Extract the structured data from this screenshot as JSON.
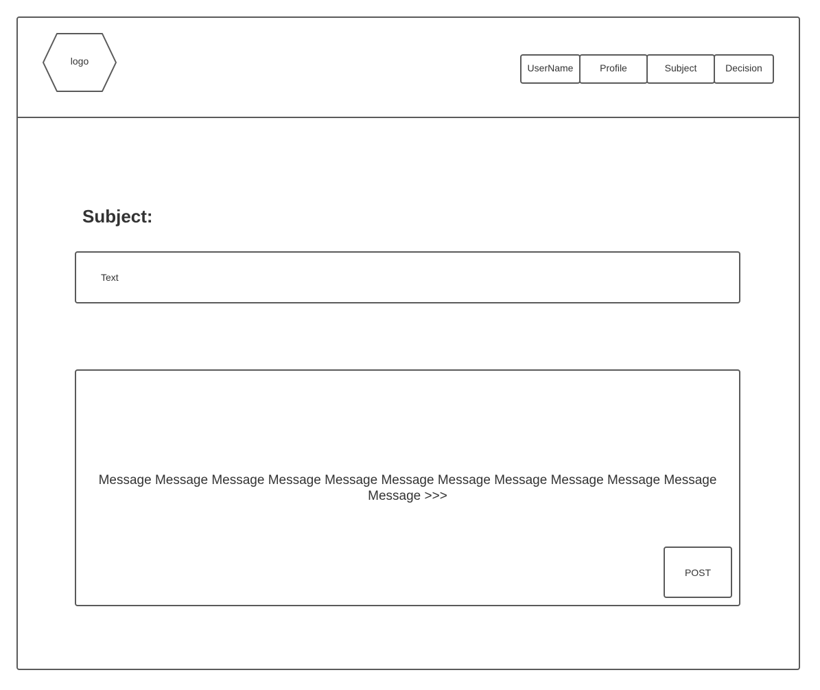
{
  "header": {
    "logo_label": "logo",
    "nav": {
      "username": "UserName",
      "profile": "Profile",
      "subject": "Subject",
      "decision": "Decision"
    }
  },
  "main": {
    "title": "Subject:",
    "subject_input": {
      "value": "Text"
    },
    "message": {
      "text": "Message Message Message Message Message Message Message Message Message Message Message Message >>>",
      "post_label": "POST"
    }
  },
  "colors": {
    "border": "#5a5a5a",
    "text": "#333333",
    "background": "#ffffff"
  }
}
